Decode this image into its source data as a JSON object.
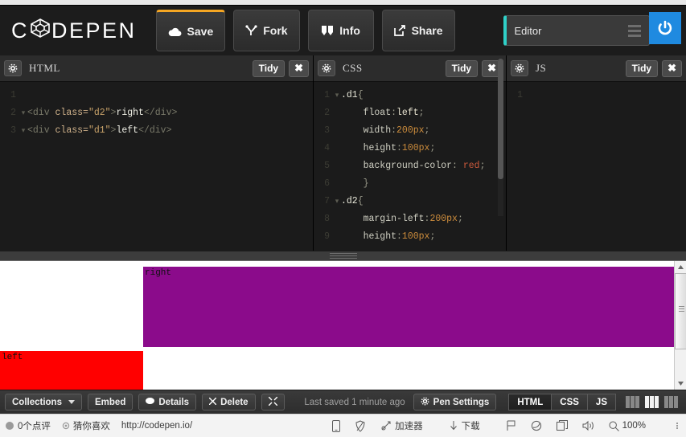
{
  "brand": {
    "name_left": "C",
    "name_right": "DEPEN",
    "gem_icon": "gem-icon"
  },
  "toolbar": {
    "buttons": [
      {
        "label": "Save",
        "icon": "cloud-icon"
      },
      {
        "label": "Fork",
        "icon": "fork-icon"
      },
      {
        "label": "Info",
        "icon": "info-icon"
      },
      {
        "label": "Share",
        "icon": "share-icon"
      }
    ],
    "editor_select": {
      "label": "Editor",
      "icon": "menu-bars-icon",
      "accent": "#2fd0c8"
    },
    "caret_icon": "chevron-down-icon",
    "power": {
      "icon": "power-icon",
      "color": "#1f8ae0"
    }
  },
  "panes": [
    {
      "title": "HTML",
      "gear_icon": "gear-icon",
      "tidy_label": "Tidy",
      "close_label": "✖",
      "lines": [
        {
          "num": "1",
          "fold": "",
          "tokens": []
        },
        {
          "num": "2",
          "fold": "▾",
          "tokens": [
            {
              "t": "<div ",
              "c": "tk-tag"
            },
            {
              "t": "class=",
              "c": "tk-attr"
            },
            {
              "t": "\"d2\"",
              "c": "tk-str"
            },
            {
              "t": ">",
              "c": "tk-tag"
            },
            {
              "t": "right",
              "c": "tk-txt"
            },
            {
              "t": "</div>",
              "c": "tk-tag"
            }
          ]
        },
        {
          "num": "3",
          "fold": "▾",
          "tokens": [
            {
              "t": "<div ",
              "c": "tk-tag"
            },
            {
              "t": "class=",
              "c": "tk-attr"
            },
            {
              "t": "\"d1\"",
              "c": "tk-str"
            },
            {
              "t": ">",
              "c": "tk-tag"
            },
            {
              "t": "left",
              "c": "tk-txt"
            },
            {
              "t": "</div>",
              "c": "tk-tag"
            }
          ]
        }
      ]
    },
    {
      "title": "CSS",
      "gear_icon": "gear-icon",
      "tidy_label": "Tidy",
      "close_label": "✖",
      "lines": [
        {
          "num": "1",
          "fold": "▾",
          "tokens": [
            {
              "t": ".d1",
              "c": "tk-sel"
            },
            {
              "t": "{",
              "c": "tk-punc"
            }
          ]
        },
        {
          "num": "2",
          "fold": "",
          "tokens": [
            {
              "t": "    float",
              "c": "tk-prop"
            },
            {
              "t": ":",
              "c": "tk-punc"
            },
            {
              "t": "left",
              "c": "tk-val"
            },
            {
              "t": ";",
              "c": "tk-punc"
            }
          ]
        },
        {
          "num": "3",
          "fold": "",
          "tokens": [
            {
              "t": "    width",
              "c": "tk-prop"
            },
            {
              "t": ":",
              "c": "tk-punc"
            },
            {
              "t": "200px",
              "c": "tk-num"
            },
            {
              "t": ";",
              "c": "tk-punc"
            }
          ]
        },
        {
          "num": "4",
          "fold": "",
          "tokens": [
            {
              "t": "    height",
              "c": "tk-prop"
            },
            {
              "t": ":",
              "c": "tk-punc"
            },
            {
              "t": "100px",
              "c": "tk-num"
            },
            {
              "t": ";",
              "c": "tk-punc"
            }
          ]
        },
        {
          "num": "5",
          "fold": "",
          "tokens": [
            {
              "t": "    background-color",
              "c": "tk-prop"
            },
            {
              "t": ": ",
              "c": "tk-punc"
            },
            {
              "t": "red",
              "c": "tk-red"
            },
            {
              "t": ";",
              "c": "tk-punc"
            }
          ]
        },
        {
          "num": "6",
          "fold": "",
          "tokens": [
            {
              "t": "    }",
              "c": "tk-punc"
            }
          ]
        },
        {
          "num": "7",
          "fold": "▾",
          "tokens": [
            {
              "t": ".d2",
              "c": "tk-sel"
            },
            {
              "t": "{",
              "c": "tk-punc"
            }
          ]
        },
        {
          "num": "8",
          "fold": "",
          "tokens": [
            {
              "t": "    margin-left",
              "c": "tk-prop"
            },
            {
              "t": ":",
              "c": "tk-punc"
            },
            {
              "t": "200px",
              "c": "tk-num"
            },
            {
              "t": ";",
              "c": "tk-punc"
            }
          ]
        },
        {
          "num": "9",
          "fold": "",
          "tokens": [
            {
              "t": "    height",
              "c": "tk-prop"
            },
            {
              "t": ":",
              "c": "tk-punc"
            },
            {
              "t": "100px",
              "c": "tk-num"
            },
            {
              "t": ";",
              "c": "tk-punc"
            }
          ]
        }
      ]
    },
    {
      "title": "JS",
      "gear_icon": "gear-icon",
      "tidy_label": "Tidy",
      "close_label": "✖",
      "lines": [
        {
          "num": "1",
          "fold": "",
          "tokens": []
        }
      ]
    }
  ],
  "preview": {
    "d2": {
      "label": "right",
      "color": "#8b0b8b"
    },
    "d1": {
      "label": "left",
      "color": "#ff0000"
    },
    "scrollbar": {
      "up_icon": "scroll-up-arrow-icon",
      "down_icon": "scroll-down-arrow-icon"
    }
  },
  "bottombar": {
    "collections_label": "Collections",
    "embed_label": "Embed",
    "details_label": "Details",
    "delete_label": "Delete",
    "fullscreen_icon": "fullscreen-icon",
    "saved_text": "Last saved 1 minute ago",
    "pen_settings_label": "Pen Settings",
    "segments": [
      {
        "label": "HTML",
        "active": true
      },
      {
        "label": "CSS",
        "active": false
      },
      {
        "label": "JS",
        "active": false
      }
    ],
    "layouts": [
      {
        "name": "layout-left-icon",
        "selected": false
      },
      {
        "name": "layout-center-icon",
        "selected": true
      },
      {
        "name": "layout-right-icon",
        "selected": false
      }
    ]
  },
  "statusbar": {
    "comments": "0个点评",
    "recommend": "猜你喜欢",
    "url": "http://codepen.io/",
    "right_items": [
      {
        "label": "",
        "icon": "phone-icon"
      },
      {
        "label": "",
        "icon": "shield-icon"
      },
      {
        "label": "加速器",
        "icon": "rocket-icon"
      },
      {
        "label": "下载",
        "icon": "download-icon"
      },
      {
        "label": "",
        "icon": "flag-icon"
      },
      {
        "label": "",
        "icon": "leaf-icon"
      },
      {
        "label": "",
        "icon": "window-icon"
      },
      {
        "label": "",
        "icon": "speaker-icon"
      },
      {
        "label": "100%",
        "icon": "zoom-icon"
      }
    ]
  }
}
